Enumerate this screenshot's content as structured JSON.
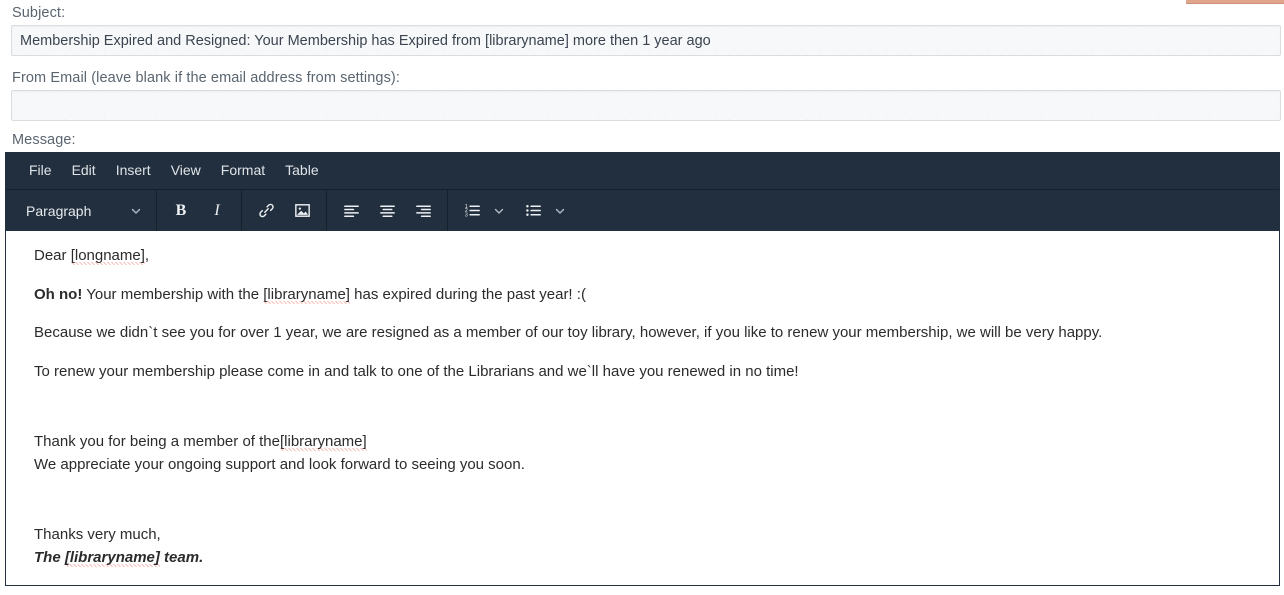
{
  "form": {
    "subject": {
      "label": "Subject:",
      "value": "Membership Expired and Resigned: Your Membership has Expired from [libraryname] more then 1 year ago",
      "placeholder": ""
    },
    "from_email": {
      "label": "From Email (leave blank if the email address from settings):",
      "value": "",
      "placeholder": ""
    },
    "message": {
      "label": "Message:"
    }
  },
  "editor": {
    "menubar": [
      {
        "label": "File"
      },
      {
        "label": "Edit"
      },
      {
        "label": "Insert"
      },
      {
        "label": "View"
      },
      {
        "label": "Format"
      },
      {
        "label": "Table"
      }
    ],
    "toolbar": {
      "format_select": "Paragraph",
      "bold_label": "B",
      "italic_label": "I",
      "buttons": [
        "bold",
        "italic",
        "link",
        "image",
        "align-left",
        "align-center",
        "align-right",
        "numbered-list",
        "bullet-list"
      ]
    },
    "content": {
      "p1_a": "Dear ",
      "p1_b": "[longname]",
      "p1_c": ",",
      "p2_bold": "Oh no!",
      "p2_a": " Your membership with the ",
      "p2_b": "[libraryname]",
      "p2_c": " has expired during the past year! :(",
      "p3": "Because we didn`t see you for over 1 year, we are resigned as a member of our toy library, however, if you like to renew your membership, we will be very happy.",
      "p4": "To renew your membership please come in and talk to one of the Librarians and we`ll have you renewed in no time!",
      "p5_a": "Thank you for being a member of the",
      "p5_b": "[libraryname]",
      "p6": "We appreciate your ongoing support and look forward to seeing you soon.",
      "p7": "Thanks very much,",
      "p8_a": "The ",
      "p8_b": "[libraryname]",
      "p8_c": " team."
    }
  },
  "colors": {
    "toolbar_bg": "#222f3e",
    "accent_bar": "#dfa68d",
    "label_text": "#5a6570",
    "body_text": "#2b2b2b",
    "spellcheck_underline": "#e8432f",
    "input_bg": "#f7f8f9",
    "input_border": "#d8dde2"
  }
}
